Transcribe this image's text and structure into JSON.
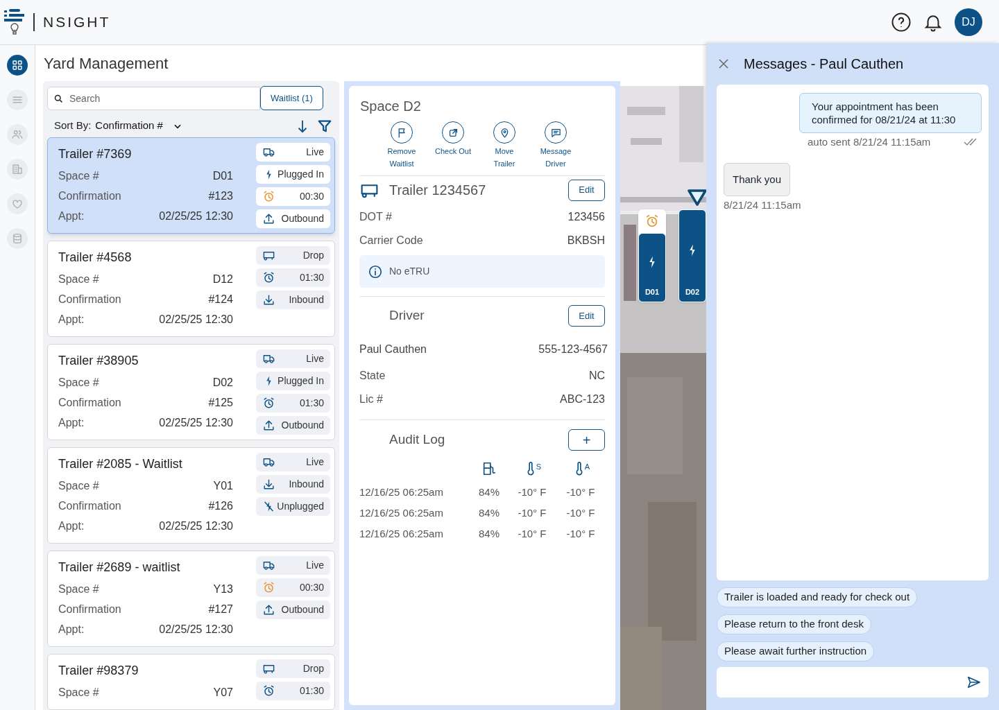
{
  "header": {
    "brand": "NSIGHT",
    "avatar": "DJ"
  },
  "nav": [
    {
      "selected": true
    },
    {
      "selected": false
    },
    {
      "selected": false
    },
    {
      "selected": false
    },
    {
      "selected": false
    },
    {
      "selected": false
    }
  ],
  "page_title": "Yard Management",
  "list": {
    "search_placeholder": "Search",
    "waitlist_button": "Waitlist (1)",
    "sort_label": "Sort By:",
    "sort_value": "Confirmation #",
    "trailers": [
      {
        "title": "Trailer #7369",
        "selected": true,
        "fields": [
          {
            "label": "Space #",
            "value": "D01"
          },
          {
            "label": "Confirmation",
            "value": "#123"
          },
          {
            "label": "Appt:",
            "value": "02/25/25 12:30"
          }
        ],
        "tags": [
          {
            "kind": "truck",
            "text": "Live"
          },
          {
            "kind": "plug",
            "text": "Plugged In"
          },
          {
            "kind": "timer",
            "urgent": true,
            "text": "00:30"
          },
          {
            "kind": "outbound",
            "text": "Outbound"
          }
        ]
      },
      {
        "title": "Trailer #4568",
        "selected": false,
        "fields": [
          {
            "label": "Space #",
            "value": "D12"
          },
          {
            "label": "Confirmation",
            "value": "#124"
          },
          {
            "label": "Appt:",
            "value": "02/25/25 12:30"
          }
        ],
        "tags": [
          {
            "kind": "trailer",
            "text": "Drop"
          },
          {
            "kind": "timer",
            "urgent": false,
            "text": "01:30"
          },
          {
            "kind": "inbound",
            "text": "Inbound"
          }
        ]
      },
      {
        "title": "Trailer #38905",
        "selected": false,
        "fields": [
          {
            "label": "Space #",
            "value": "D02"
          },
          {
            "label": "Confirmation",
            "value": "#125"
          },
          {
            "label": "Appt:",
            "value": "02/25/25 12:30"
          }
        ],
        "tags": [
          {
            "kind": "truck",
            "text": "Live"
          },
          {
            "kind": "plug",
            "text": "Plugged In"
          },
          {
            "kind": "timer",
            "urgent": false,
            "text": "01:30"
          },
          {
            "kind": "outbound",
            "text": "Outbound"
          }
        ]
      },
      {
        "title": "Trailer #2085 - Waitlist",
        "selected": false,
        "fields": [
          {
            "label": "Space #",
            "value": "Y01"
          },
          {
            "label": "Confirmation",
            "value": "#126"
          },
          {
            "label": "Appt:",
            "value": "02/25/25 12:30"
          }
        ],
        "tags": [
          {
            "kind": "truck",
            "text": "Live"
          },
          {
            "kind": "inbound",
            "text": "Inbound"
          },
          {
            "kind": "unplug",
            "text": "Unplugged"
          }
        ]
      },
      {
        "title": "Trailer #2689 - waitlist",
        "selected": false,
        "fields": [
          {
            "label": "Space #",
            "value": "Y13"
          },
          {
            "label": "Confirmation",
            "value": "#127"
          },
          {
            "label": "Appt:",
            "value": "02/25/25 12:30"
          }
        ],
        "tags": [
          {
            "kind": "truck",
            "text": "Live"
          },
          {
            "kind": "timer",
            "urgent": true,
            "text": "00:30"
          },
          {
            "kind": "outbound",
            "text": "Outbound"
          }
        ]
      },
      {
        "title": "Trailer #98379",
        "selected": false,
        "fields": [
          {
            "label": "Space #",
            "value": "Y07"
          }
        ],
        "tags": [
          {
            "kind": "trailer",
            "text": "Drop"
          },
          {
            "kind": "timer",
            "urgent": false,
            "text": "01:30"
          }
        ]
      }
    ]
  },
  "detail": {
    "title": "Space D2",
    "actions": [
      {
        "label": "Remove Waitlist"
      },
      {
        "label": "Check Out"
      },
      {
        "label": "Move Trailer"
      },
      {
        "label": "Message Driver"
      }
    ],
    "trailer": {
      "title": "Trailer 1234567",
      "edit": "Edit",
      "fields": [
        {
          "label": "DOT #",
          "value": "123456"
        },
        {
          "label": "Carrier Code",
          "value": "BKBSH"
        }
      ],
      "notice": "No eTRU"
    },
    "driver": {
      "title": "Driver",
      "edit": "Edit",
      "name": "Paul Cauthen",
      "phone": "555-123-4567",
      "fields": [
        {
          "label": "State",
          "value": "NC"
        },
        {
          "label": "Lic #",
          "value": "ABC-123"
        }
      ]
    },
    "audit": {
      "title": "Audit Log",
      "add": "+",
      "columns": [
        "",
        "",
        "S",
        "A"
      ],
      "rows": [
        [
          "12/16/25 06:25am",
          "84%",
          "-10° F",
          "-10° F"
        ],
        [
          "12/16/25 06:25am",
          "84%",
          "-10° F",
          "-10° F"
        ],
        [
          "12/16/25 06:25am",
          "84%",
          "-10° F",
          "-10° F"
        ]
      ]
    }
  },
  "map": {
    "spots": [
      {
        "label": "D01",
        "alarm": true,
        "selected": false
      },
      {
        "label": "D02",
        "alarm": false,
        "selected": true
      }
    ]
  },
  "messages": {
    "title": "Messages - Paul Cauthen",
    "items": [
      {
        "kind": "outgoing",
        "text": "Your appointment has been confirmed for 08/21/24 at 11:30",
        "meta": "auto sent 8/21/24 11:15am",
        "read": true
      },
      {
        "kind": "incoming",
        "text": "Thank you",
        "meta": "8/21/24 11:15am"
      }
    ],
    "quick_replies": [
      "Trailer is loaded and ready for check out",
      "Please return to the front desk",
      "Please await further instruction"
    ]
  }
}
